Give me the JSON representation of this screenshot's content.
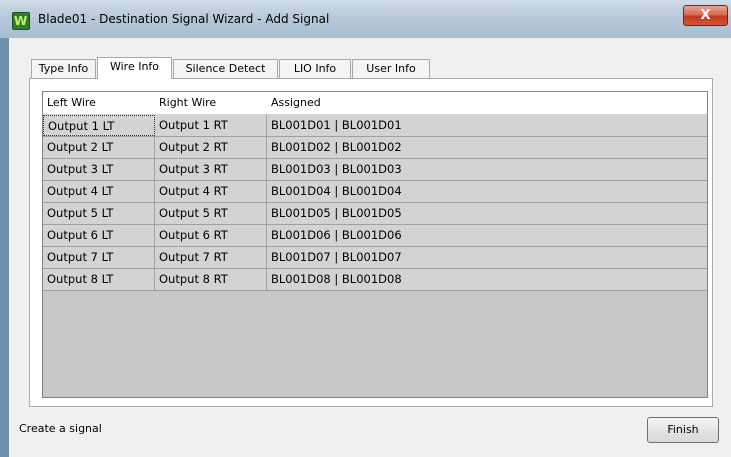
{
  "window": {
    "title": "Blade01 - Destination Signal Wizard - Add Signal",
    "close_glyph": "X"
  },
  "tabs": [
    {
      "label": "Type Info"
    },
    {
      "label": "Wire Info",
      "active": true
    },
    {
      "label": "Silence Detect"
    },
    {
      "label": "LIO Info"
    },
    {
      "label": "User Info"
    }
  ],
  "table": {
    "columns": [
      "Left Wire",
      "Right Wire",
      "Assigned"
    ],
    "rows": [
      [
        "Output 1 LT",
        "Output 1 RT",
        "BL001D01 | BL001D01"
      ],
      [
        "Output 2 LT",
        "Output 2 RT",
        "BL001D02 | BL001D02"
      ],
      [
        "Output 3 LT",
        "Output 3 RT",
        "BL001D03 | BL001D03"
      ],
      [
        "Output 4 LT",
        "Output 4 RT",
        "BL001D04 | BL001D04"
      ],
      [
        "Output 5 LT",
        "Output 5 RT",
        "BL001D05 | BL001D05"
      ],
      [
        "Output 6 LT",
        "Output 6 RT",
        "BL001D06 | BL001D06"
      ],
      [
        "Output 7 LT",
        "Output 7 RT",
        "BL001D07 | BL001D07"
      ],
      [
        "Output 8 LT",
        "Output 8 RT",
        "BL001D08 | BL001D08"
      ]
    ]
  },
  "footer": {
    "status": "Create a signal",
    "finish_label": "Finish"
  }
}
